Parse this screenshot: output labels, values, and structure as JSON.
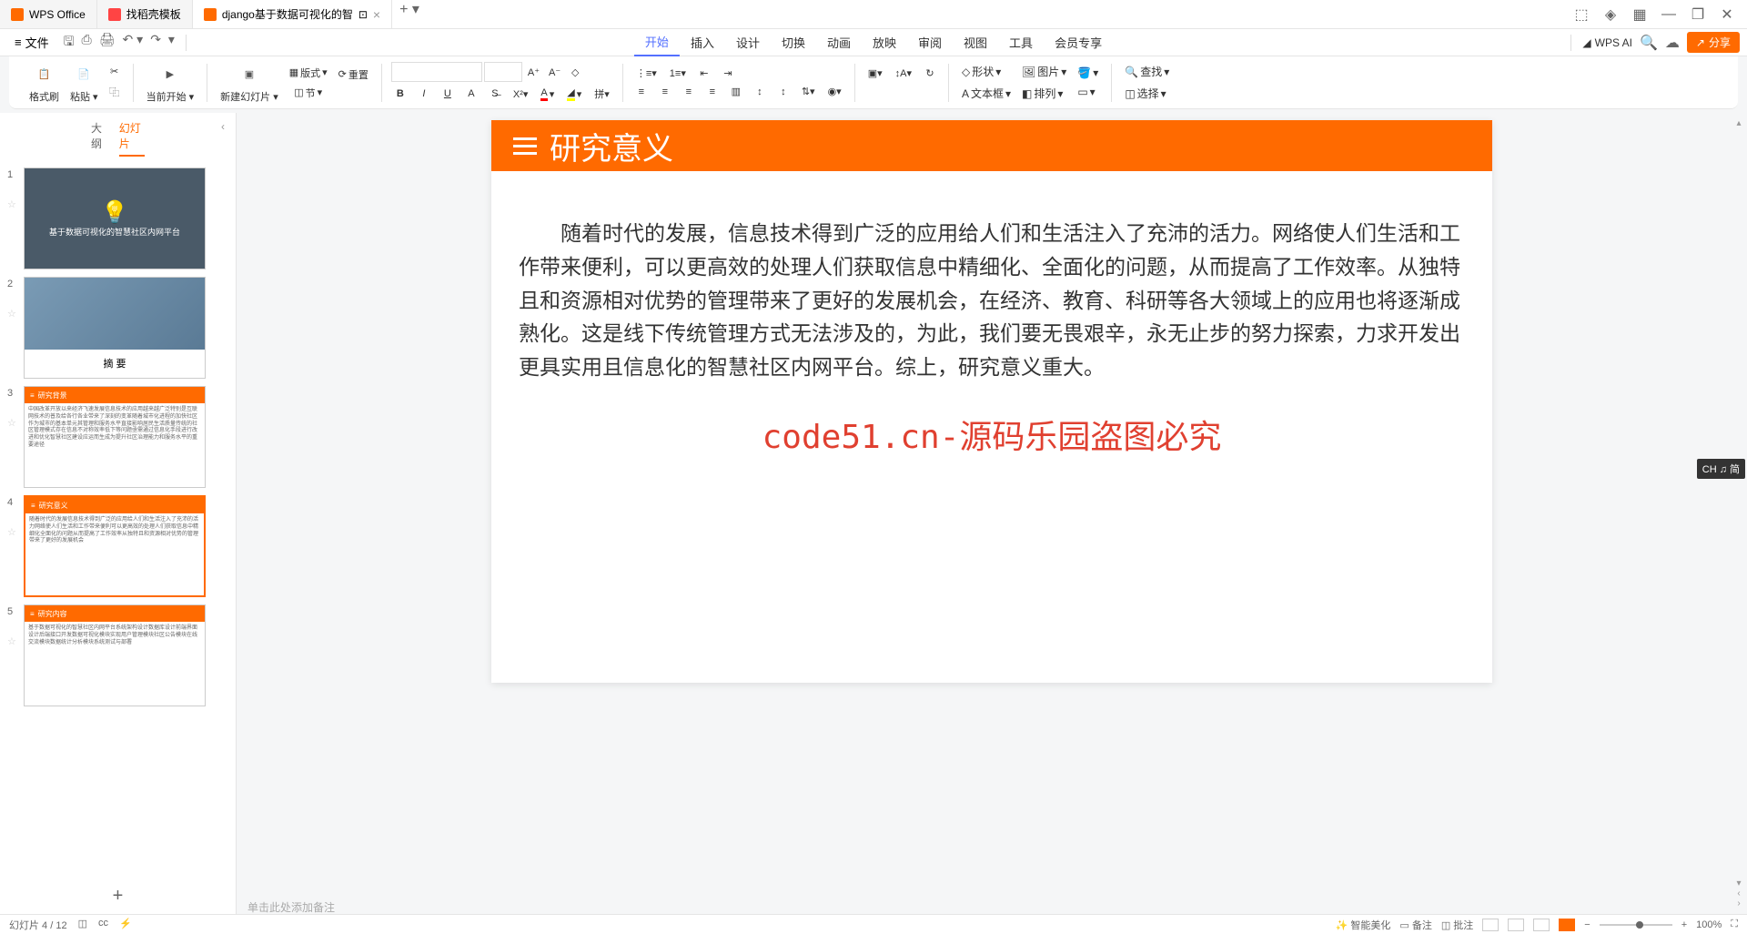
{
  "app": {
    "tabs": [
      {
        "label": "WPS Office"
      },
      {
        "label": "找稻壳模板"
      },
      {
        "label": "django基于数据可视化的智",
        "active": true
      }
    ]
  },
  "menubar": {
    "file": "文件",
    "items": [
      "开始",
      "插入",
      "设计",
      "切换",
      "动画",
      "放映",
      "审阅",
      "视图",
      "工具",
      "会员专享"
    ],
    "active": "开始",
    "wps_ai": "WPS AI",
    "share": "分享"
  },
  "ribbon": {
    "g1": {
      "format": "格式刷",
      "paste": "粘贴"
    },
    "g2": {
      "fromcurrent": "当前开始",
      "newslide": "新建幻灯片",
      "layout": "版式",
      "section": "节",
      "reset": "重置"
    },
    "g3": {
      "shape": "形状",
      "picture": "图片",
      "textbox": "文本框",
      "arrange": "排列",
      "find": "查找",
      "select": "选择"
    }
  },
  "outline": {
    "tabs": {
      "outline": "大纲",
      "slides": "幻灯片"
    }
  },
  "slides": {
    "s1_title": "基于数据可视化的智慧社区内网平台",
    "s2_title": "摘    要",
    "s3_hdr": "研究背景",
    "s4_hdr": "研究意义",
    "s5_hdr": "研究内容"
  },
  "current_slide": {
    "title": "研究意义",
    "body": "随着时代的发展，信息技术得到广泛的应用给人们和生活注入了充沛的活力。网络使人们生活和工作带来便利，可以更高效的处理人们获取信息中精细化、全面化的问题，从而提高了工作效率。从独特且和资源相对优势的管理带来了更好的发展机会，在经济、教育、科研等各大领域上的应用也将逐渐成熟化。这是线下传统管理方式无法涉及的，为此，我们要无畏艰辛，永无止步的努力探索，力求开发出更具实用且信息化的智慧社区内网平台。综上，研究意义重大。",
    "watermark": "code51.cn-源码乐园盗图必究"
  },
  "notes_placeholder": "单击此处添加备注",
  "status": {
    "slide_info": "幻灯片 4 / 12",
    "smart": "智能美化",
    "notes": "备注",
    "batch": "批注",
    "zoom": "100%"
  },
  "ime": "CH ♫ 简"
}
